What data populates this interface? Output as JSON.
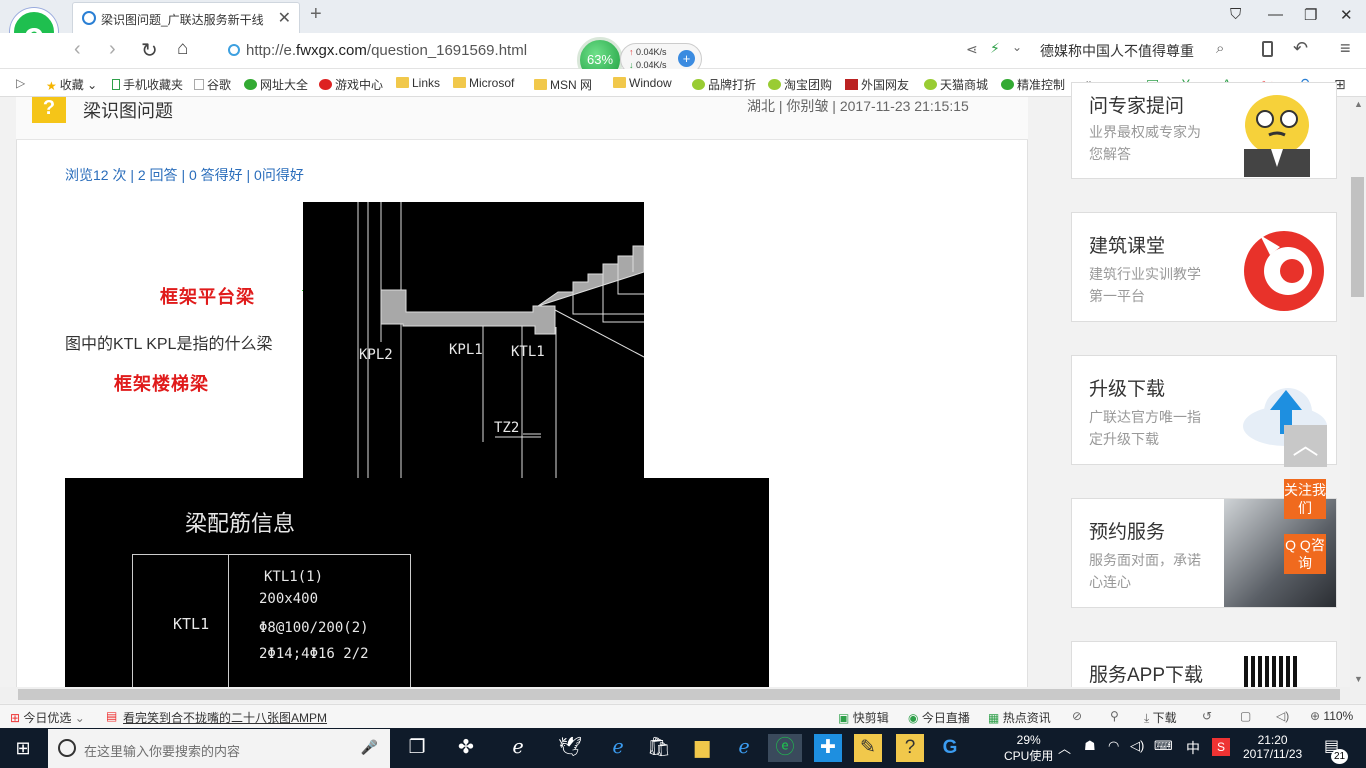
{
  "browser": {
    "tab_title": "梁识图问题_广联达服务新干线",
    "url_prefix": "http://e.",
    "url_domain": "fwxgx.com",
    "url_path": "/question_1691569.html",
    "cpu_gauge": "63%",
    "upload_speed": "0.04K/s",
    "download_speed": "0.04K/s",
    "news_ticker": "德媒称中国人不值得尊重"
  },
  "bookmarks": [
    "收藏",
    "手机收藏夹",
    "谷歌",
    "网址大全",
    "游戏中心",
    "Links",
    "Microsof",
    "MSN 网",
    "Window",
    "品牌打折",
    "淘宝团购",
    "外国网友",
    "天猫商城",
    "精准控制"
  ],
  "question": {
    "title": "梁识图问题",
    "meta": "湖北 | 你别皱 | 2017-11-23 21:15:15",
    "stats": "浏览12 次 | 2 回答 | 0 答得好 | 0问得好",
    "text": "图中的KTL   KPL是指的什么梁",
    "annotation_1": "框架平台梁",
    "annotation_2": "框架楼梯梁"
  },
  "cad_top": {
    "labels": [
      "KPL2",
      "KPL1",
      "KTL1",
      "TZ2"
    ]
  },
  "cad_bottom": {
    "heading": "梁配筋信息",
    "beam_id": "KTL1",
    "spec_name": "KTL1(1)",
    "spec_size": "200x400",
    "spec_stirrup": "Φ8@100/200(2)",
    "spec_bars": "2Φ14;4Φ16 2/2"
  },
  "sidebar": [
    {
      "title": "问专家提问",
      "desc": "业界最权威专家为您解答"
    },
    {
      "title": "建筑课堂",
      "desc": "建筑行业实训教学第一平台"
    },
    {
      "title": "升级下载",
      "desc": "广联达官方唯一指定升级下载"
    },
    {
      "title": "预约服务",
      "desc": "服务面对面，承诺心连心"
    },
    {
      "title": "服务APP下载",
      "desc": ""
    }
  ],
  "float": {
    "follow": "关注我们",
    "qq": "Q Q咨询"
  },
  "statusbar": {
    "left": "今日优选",
    "news": "看完笑到合不拢嘴的二十八张图AMPM",
    "quick_cut": "快剪辑",
    "live": "今日直播",
    "hot": "热点资讯",
    "download": "下载",
    "zoom": "110%"
  },
  "taskbar": {
    "search_placeholder": "在这里输入你要搜索的内容",
    "cpu_percent": "29%",
    "cpu_label": "CPU使用",
    "ime": "中",
    "time": "21:20",
    "date": "2017/11/23",
    "notify_count": "21"
  }
}
